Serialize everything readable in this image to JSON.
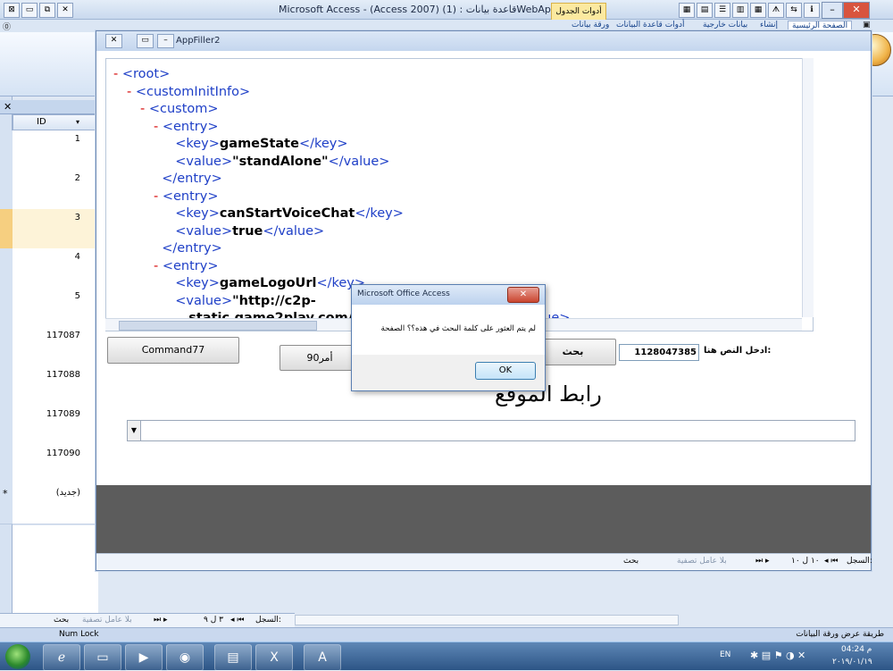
{
  "window": {
    "title": "Microsoft Access - (Access 2007) قاعدة بيانات : (1)WebAppFiller (1)",
    "context_tab": "أدوات الجدول"
  },
  "ribbon": {
    "tabs": [
      "الصفحة الرئيسية",
      "إنشاء",
      "بيانات خارجية",
      "أدوات قاعدة البيانات",
      "ورقة بيانات"
    ]
  },
  "datasheet": {
    "column_header": "ID",
    "rows": [
      "1",
      "2",
      "3",
      "4",
      "5",
      "117087",
      "117088",
      "117089",
      "117090"
    ],
    "new_row_label": "(جديد)",
    "new_row_marker": "*",
    "nav": {
      "record_label": "السجل:",
      "position": "٣ ل ٩",
      "filter": "بلا عامل تصفية",
      "search": "بحث"
    }
  },
  "statusbar": {
    "left": "Num Lock",
    "right": "طريقة عرض ورقة البيانات"
  },
  "form": {
    "title": "AppFiller2",
    "xml_lines": [
      {
        "indent": 0,
        "m": "-",
        "open": "<root>"
      },
      {
        "indent": 1,
        "m": "-",
        "open": "<customInitInfo>"
      },
      {
        "indent": 2,
        "m": "-",
        "open": "<custom>"
      },
      {
        "indent": 3,
        "m": "-",
        "open": "<entry>"
      },
      {
        "indent": 4,
        "m": "",
        "open": "<key>",
        "text": "gameState",
        "close": "</key>"
      },
      {
        "indent": 4,
        "m": "",
        "open": "<value>",
        "text": "\"standAlone\"",
        "close": "</value>"
      },
      {
        "indent": 3,
        "m": "",
        "open": "</entry>"
      },
      {
        "indent": 3,
        "m": "-",
        "open": "<entry>"
      },
      {
        "indent": 4,
        "m": "",
        "open": "<key>",
        "text": "canStartVoiceChat",
        "close": "</key>"
      },
      {
        "indent": 4,
        "m": "",
        "open": "<value>",
        "text": "true",
        "close": "</value>"
      },
      {
        "indent": 3,
        "m": "",
        "open": "</entry>"
      },
      {
        "indent": 3,
        "m": "-",
        "open": "<entry>"
      },
      {
        "indent": 4,
        "m": "",
        "open": "<key>",
        "text": "gameLogoUrl",
        "close": "</key>"
      },
      {
        "indent": 4,
        "m": "",
        "open": "<value>",
        "text": "\"http://c2p-",
        "close": ""
      },
      {
        "indent": 5,
        "m": "",
        "open": "",
        "text": "static.game2play.com/...animatedLogo.swf\"",
        "close": "</value>"
      }
    ],
    "command77_label": "Command77",
    "command90_label": "أمر90",
    "search_button_label": "بحث",
    "search_input_value": "1128047385",
    "search_label": "ادخل النص هنا:",
    "site_link_label": "رابط الموقع",
    "nav": {
      "record_label": "السجل:",
      "position": "١٠ ل ١٠",
      "filter": "بلا عامل تصفية",
      "search": "بحث"
    }
  },
  "dialog": {
    "title": "Microsoft Office Access",
    "message": "لم يتم العثور على كلمة البحث في هذه؟؟ الصفحة",
    "ok_label": "OK",
    "close_glyph": "✕"
  },
  "taskbar": {
    "lang": "EN",
    "time": "م 04:24",
    "date": "٢٠١٩/٠١/١٩"
  }
}
